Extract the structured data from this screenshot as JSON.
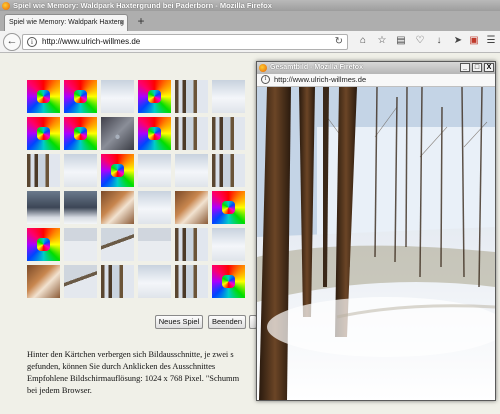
{
  "main_window": {
    "title": "Spiel wie Memory: Waldpark Haxtergrund bei Paderborn - Mozilla Firefox",
    "tab_title": "Spiel wie Memory: Waldpark Haxterg",
    "tab_close": "×",
    "new_tab": "+",
    "url": "http://www.ulrich-willmes.de"
  },
  "toolbar_icons": [
    "back-arrow-icon",
    "info-icon",
    "reload-icon",
    "home-icon",
    "bookmark-star-icon",
    "clipboard-icon",
    "pocket-icon",
    "download-icon",
    "send-icon",
    "pdf-icon",
    "hamburger-menu-icon"
  ],
  "grid": {
    "columns": 6,
    "rows": 6,
    "cells": [
      "rainbow",
      "rainbow",
      "snow",
      "rainbow",
      "trees",
      "snow",
      "rainbow",
      "rainbow",
      "dark",
      "rainbow",
      "trees",
      "trees",
      "trees",
      "snow",
      "rainbow",
      "snow",
      "house",
      "trees",
      "forest",
      "forest",
      "brown",
      "snow",
      "brown",
      "rainbow",
      "rainbow",
      "people",
      "tracks",
      "people",
      "trees",
      "snow",
      "brown",
      "tracks",
      "trees",
      "snow",
      "trees",
      "rainbow"
    ]
  },
  "buttons": {
    "new_game": "Neues Spiel",
    "end": "Beenden"
  },
  "paragraph_lines": [
    "Hinter den Kärtchen verbergen sich Bildausschnitte, je zwei s",
    "gefunden, können Sie durch Anklicken des Ausschnittes",
    "Empfohlene Bildschirmauflösung: 1024 x 768 Pixel. \"Schumm",
    "bei jedem Browser."
  ],
  "popup": {
    "title": "Gesamtbild - Mozilla Firefox",
    "url": "http://www.ulrich-willmes.de",
    "controls": [
      "_",
      "□",
      "X"
    ]
  },
  "colors": {
    "page_background": "#f0f0e8",
    "titlebar": "#a8a8a8"
  }
}
